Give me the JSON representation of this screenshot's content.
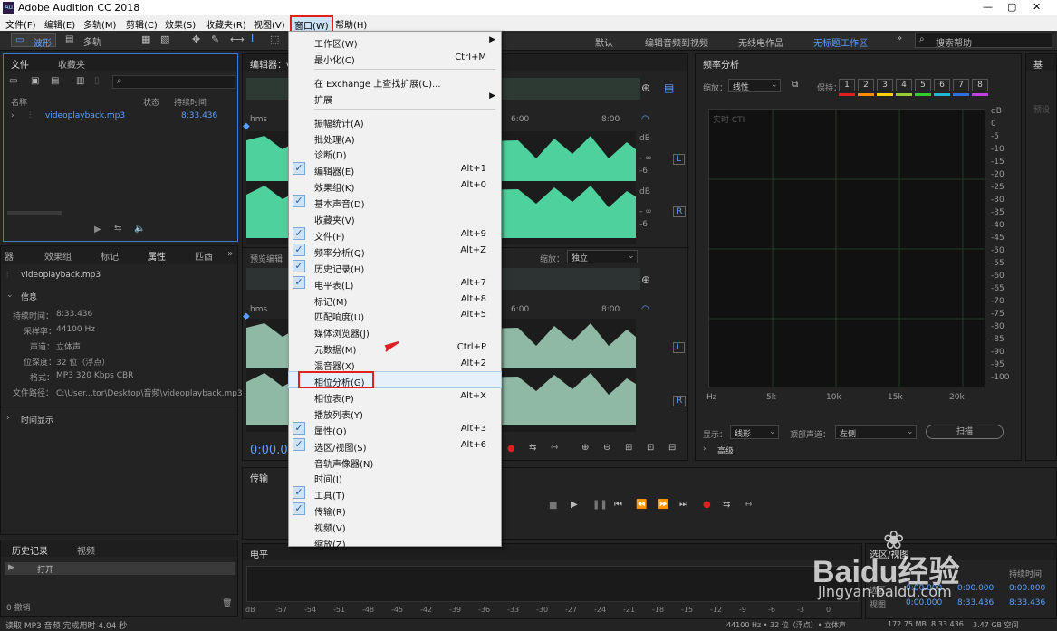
{
  "title": {
    "app": "Adobe Audition CC 2018",
    "icon": "Au",
    "min": "—",
    "max": "▢",
    "close": "✕"
  },
  "menubar": [
    "文件(F)",
    "编辑(E)",
    "多轨(M)",
    "剪辑(C)",
    "效果(S)",
    "收藏夹(R)",
    "视图(V)",
    "窗口(W)",
    "帮助(H)"
  ],
  "toolbar": {
    "waveform": "波形",
    "multitrack": "多轨",
    "workspaces": [
      "默认",
      "编辑音频到视频",
      "无线电作品",
      "无标题工作区"
    ],
    "search_placeholder": "搜索帮助"
  },
  "files_panel": {
    "tabs": [
      "文件",
      "收藏夹"
    ],
    "col_name": "名称",
    "col_status": "状态",
    "col_duration": "持续时间",
    "file": "videoplayback.mp3",
    "duration": "8:33.436"
  },
  "props_panel": {
    "tabs": [
      "器",
      "效果组",
      "标记",
      "属性",
      "匹酉"
    ],
    "file": "videoplayback.mp3",
    "info": "信息",
    "rows": [
      [
        "持续时间：",
        "8:33.436"
      ],
      [
        "采样率：",
        "44100 Hz"
      ],
      [
        "声道：",
        "立体声"
      ],
      [
        "位深度：",
        "32 位（浮点）"
      ],
      [
        "格式：",
        "MP3 320 Kbps CBR"
      ],
      [
        "文件路径：",
        "C:\\User...tor\\Desktop\\音频\\videoplayback.mp3"
      ]
    ],
    "time_display": "时间显示"
  },
  "history_panel": {
    "tabs": [
      "历史记录",
      "视频"
    ],
    "item": "打开",
    "undo": "0 撤销",
    "status": "读取 MP3 音频 完成用时 4.04 秒"
  },
  "editor": {
    "title": "编辑器：vi",
    "preview_title": "预览编辑",
    "times": [
      "hms",
      "6:00",
      "8:00"
    ],
    "db": [
      "dB",
      "- ∞",
      "-6",
      "dB",
      "- ∞",
      "-6"
    ],
    "ch": [
      "L",
      "R",
      "L",
      "R"
    ],
    "zoom_label": "缩放：",
    "zoom_value": "独立",
    "time": "0:00.00"
  },
  "transport": {
    "title": "传输"
  },
  "levels": {
    "title": "电平",
    "ticks": [
      "dB",
      "-57",
      "-54",
      "-51",
      "-48",
      "-45",
      "-42",
      "-39",
      "-36",
      "-33",
      "-30",
      "-27",
      "-24",
      "-21",
      "-18",
      "-15",
      "-12",
      "-9",
      "-6",
      "-3",
      "0"
    ]
  },
  "freq_panel": {
    "title": "频率分析",
    "scale_label": "缩放：",
    "scale_value": "线性",
    "hold_label": "保持：",
    "holds": [
      "1",
      "2",
      "3",
      "4",
      "5",
      "6",
      "7",
      "8"
    ],
    "hold_colors": [
      "#e02020",
      "#ff8a00",
      "#ffd200",
      "#9acd32",
      "#33cc33",
      "#22b8cf",
      "#2f6fe0",
      "#c040e0"
    ],
    "realtime": "实时 CTI",
    "db_labels": [
      "dB",
      "0",
      "-5",
      "-10",
      "-15",
      "-20",
      "-25",
      "-30",
      "-35",
      "-40",
      "-45",
      "-50",
      "-55",
      "-60",
      "-65",
      "-70",
      "-75",
      "-80",
      "-85",
      "-90",
      "-95",
      "-100"
    ],
    "hz_labels": [
      "Hz",
      "5k",
      "10k",
      "15k",
      "20k"
    ],
    "display_label": "显示：",
    "display_value": "线形",
    "top_label": "顶部声道：",
    "top_value": "左侧",
    "scan": "扫描",
    "advanced": "高级"
  },
  "right_panel": {
    "title": "基",
    "preset": "预设"
  },
  "selection_panel": {
    "title": "选区/视图",
    "duration": "持续时间",
    "sel_label": "选区",
    "view_label": "视图",
    "sel_start": "0:00.000",
    "sel_end": "0:00.000",
    "sel_dur": "0:00.000",
    "view_start": "0:00.000",
    "view_end": "8:33.436",
    "view_dur": "8:33.436"
  },
  "statusbar": {
    "rate": "44100 Hz • 32 位（浮点）• 立体声",
    "size": "172.75 MB",
    "dur": "8:33.436",
    "free": "3.47 GB 空间"
  },
  "window_menu": {
    "items": [
      {
        "label": "工作区(W)",
        "shortcut": "",
        "check": false,
        "sub": true
      },
      {
        "label": "最小化(C)",
        "shortcut": "Ctrl+M",
        "check": false,
        "sub": false
      },
      {
        "sep": true
      },
      {
        "label": "在 Exchange 上查找扩展(C)...",
        "shortcut": "",
        "check": false,
        "sub": false
      },
      {
        "label": "扩展",
        "shortcut": "",
        "check": false,
        "sub": true
      },
      {
        "sep": true
      },
      {
        "label": "振幅统计(A)",
        "shortcut": "",
        "check": false
      },
      {
        "label": "批处理(A)",
        "shortcut": "",
        "check": false
      },
      {
        "label": "诊断(D)",
        "shortcut": "",
        "check": false
      },
      {
        "label": "编辑器(E)",
        "shortcut": "Alt+1",
        "check": true
      },
      {
        "label": "效果组(K)",
        "shortcut": "Alt+0",
        "check": false
      },
      {
        "label": "基本声音(D)",
        "shortcut": "",
        "check": true
      },
      {
        "label": "收藏夹(V)",
        "shortcut": "",
        "check": false
      },
      {
        "label": "文件(F)",
        "shortcut": "Alt+9",
        "check": true
      },
      {
        "label": "频率分析(Q)",
        "shortcut": "Alt+Z",
        "check": true
      },
      {
        "label": "历史记录(H)",
        "shortcut": "",
        "check": true
      },
      {
        "label": "电平表(L)",
        "shortcut": "Alt+7",
        "check": true
      },
      {
        "label": "标记(M)",
        "shortcut": "Alt+8",
        "check": false
      },
      {
        "label": "匹配响度(U)",
        "shortcut": "Alt+5",
        "check": false
      },
      {
        "label": "媒体浏览器(J)",
        "shortcut": "",
        "check": false
      },
      {
        "label": "元数据(M)",
        "shortcut": "Ctrl+P",
        "check": false
      },
      {
        "label": "混音器(X)",
        "shortcut": "Alt+2",
        "check": false
      },
      {
        "label": "相位分析(G)",
        "shortcut": "",
        "check": false,
        "highlight": true
      },
      {
        "label": "相位表(P)",
        "shortcut": "Alt+X",
        "check": false
      },
      {
        "label": "播放列表(Y)",
        "shortcut": "",
        "check": false
      },
      {
        "label": "属性(O)",
        "shortcut": "Alt+3",
        "check": true
      },
      {
        "label": "选区/视图(S)",
        "shortcut": "Alt+6",
        "check": true
      },
      {
        "label": "音轨声像器(N)",
        "shortcut": "",
        "check": false
      },
      {
        "label": "时间(I)",
        "shortcut": "",
        "check": false
      },
      {
        "label": "工具(T)",
        "shortcut": "",
        "check": true
      },
      {
        "label": "传输(R)",
        "shortcut": "",
        "check": true
      },
      {
        "label": "视频(V)",
        "shortcut": "",
        "check": false
      },
      {
        "label": "缩放(Z)",
        "shortcut": "",
        "check": false
      }
    ]
  },
  "watermark": {
    "brand": "Baidu经验",
    "url": "jingyan.baidu.com"
  }
}
